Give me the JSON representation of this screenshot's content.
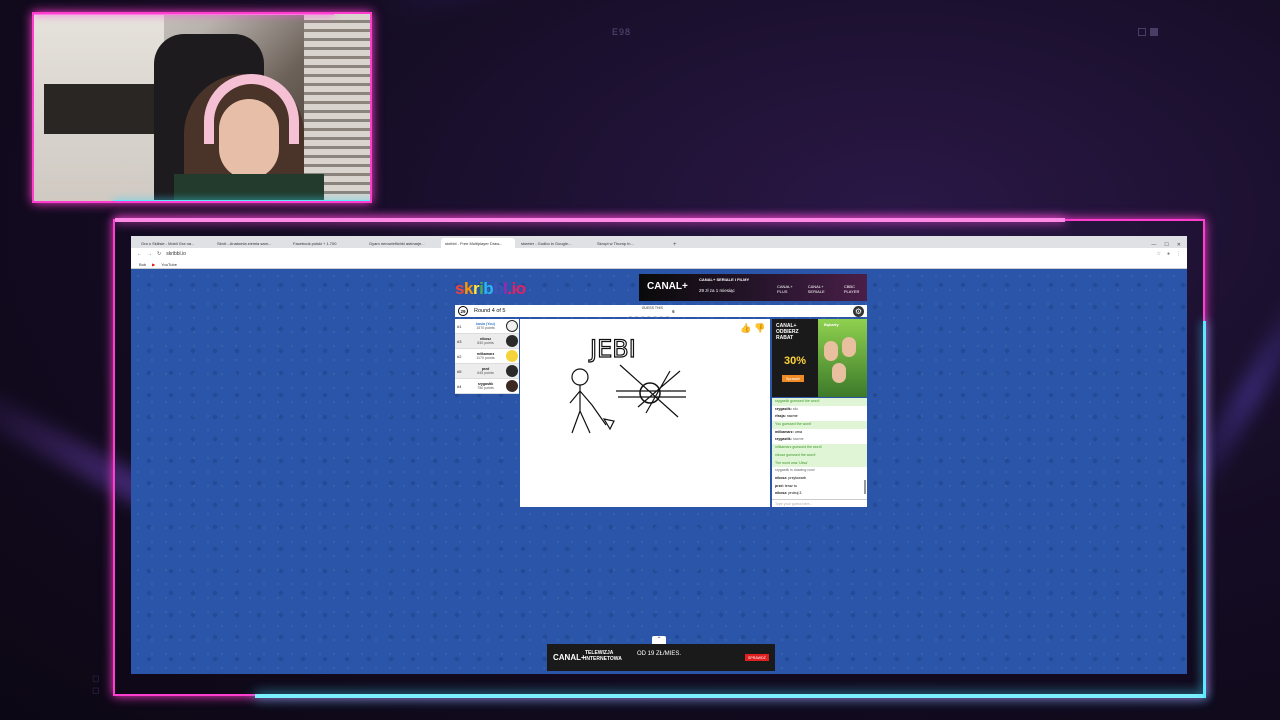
{
  "overlay": {
    "top_text": "E98"
  },
  "browser": {
    "tabs": [
      {
        "label": "Gra o Skillsie - Mobil Gra na..."
      },
      {
        "label": "Skrót - Anatomia ziemia sam..."
      },
      {
        "label": "Facebook polski + 1.700"
      },
      {
        "label": "Gyam nerowieflichki astmarje..."
      },
      {
        "label": "skribbl - Free Multiplayer Draw..."
      },
      {
        "label": "skeeter - Gudbo in Google..."
      },
      {
        "label": "Skropt w Thump In..."
      }
    ],
    "window_controls": [
      "—",
      "☐",
      "✕"
    ],
    "address": "skribbl.io",
    "bookmarks": [
      {
        "label": "Bob"
      },
      {
        "label": "YouTube"
      }
    ]
  },
  "game": {
    "logo_parts": [
      "s",
      "k",
      "r",
      "i",
      "b",
      "b",
      "l",
      ".io"
    ],
    "timer": "29",
    "round": "Round 4 of 5",
    "guess_label": "GUESS THIS",
    "word_blanks": "_ _ _ _ _ _ _",
    "word_length": "6",
    "drawing_word": "JEBI",
    "players": [
      {
        "rank": "#1",
        "name": "kasia (You)",
        "points": "1570 points",
        "me": true,
        "avatar": "#f0f0f0"
      },
      {
        "rank": "#3",
        "name": "nikosz",
        "points": "830 points",
        "me": false,
        "avatar": "#2a2a2a"
      },
      {
        "rank": "#2",
        "name": "milkamarz",
        "points": "1170 points",
        "me": false,
        "avatar": "#f5d33a"
      },
      {
        "rank": "#5",
        "name": "przd",
        "points": "645 points",
        "me": false,
        "avatar": "#2a2a2a"
      },
      {
        "rank": "#4",
        "name": "rzygastik",
        "points": "750 points",
        "me": false,
        "avatar": "#3a2a22"
      }
    ],
    "chat": [
      {
        "user": "",
        "text": "rzygastik guessed the word!",
        "type": "green"
      },
      {
        "user": "rzygastik:",
        "text": "silu",
        "type": "sys"
      },
      {
        "user": "rfasja:",
        "text": "nacme",
        "type": ""
      },
      {
        "user": "",
        "text": "You guessed the word!",
        "type": "green"
      },
      {
        "user": "milkamarz:",
        "text": "urna",
        "type": ""
      },
      {
        "user": "rzygastik:",
        "text": "nacme",
        "type": "sys"
      },
      {
        "user": "",
        "text": "milkamarz guessed the word!",
        "type": "green"
      },
      {
        "user": "",
        "text": "nikosz guessed the word!",
        "type": "green"
      },
      {
        "user": "",
        "text": "The word was 'Ulisa'",
        "type": "green"
      },
      {
        "user": "",
        "text": "rzygastik is drawing now!",
        "type": "sys"
      },
      {
        "user": "nikosz:",
        "text": "przytowarb",
        "type": ""
      },
      {
        "user": "przd:",
        "text": "teraz tu",
        "type": ""
      },
      {
        "user": "nikosz:",
        "text": "probuj 3",
        "type": ""
      }
    ],
    "chat_placeholder": "Type your guess here..."
  },
  "ads": {
    "top": {
      "brand": "CANAL+",
      "headline": "CANAL+ SERIALE I FILMY",
      "price": "29 zł za 1 miesiąc",
      "logos": [
        "CANAL+ PLUS",
        "CANAL+ SERIALE",
        "CBBC PLAYER"
      ]
    },
    "right": {
      "brand": "CANAL+",
      "line1": "ODBIERZ",
      "line2": "RABAT",
      "percent": "30%",
      "cta": "Sprawdź",
      "badge": "Bękarty"
    },
    "bottom": {
      "brand": "CANAL+",
      "line1": "TELEWIZJA",
      "line2": "INTERNETOWA",
      "price": "OD 19 ZŁ/MIES.",
      "cta": "SPRAWDŹ"
    }
  },
  "colors": {
    "neon_pink": "#ff3ecf",
    "neon_cyan": "#5ce8ff",
    "page_blue": "#2a55a8"
  }
}
